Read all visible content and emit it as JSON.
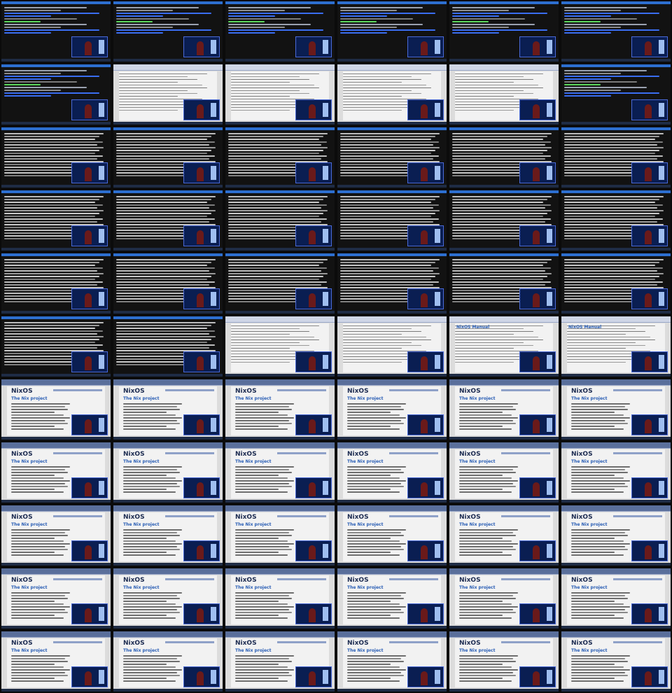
{
  "grid": {
    "cols": 6,
    "rows": 11
  },
  "rows": [
    {
      "kind": "term-code"
    },
    {
      "kind": "mixed-1"
    },
    {
      "kind": "term-list"
    },
    {
      "kind": "term-list"
    },
    {
      "kind": "term-list"
    },
    {
      "kind": "mixed-2"
    },
    {
      "kind": "nixos"
    },
    {
      "kind": "nixos"
    },
    {
      "kind": "nixos"
    },
    {
      "kind": "nixos"
    },
    {
      "kind": "nixos"
    }
  ],
  "labels": {
    "nixos_logo": "NixOS",
    "nix_heading": "The Nix project",
    "manual_heading": "NixOS Manual"
  },
  "colors": {
    "terminal_bg": "#0b0b0b",
    "terminal_green": "#5bd65b",
    "terminal_blue": "#3a6df0",
    "browser_chrome": "#cfd6e6",
    "nix_accent": "#2b5fb5"
  }
}
